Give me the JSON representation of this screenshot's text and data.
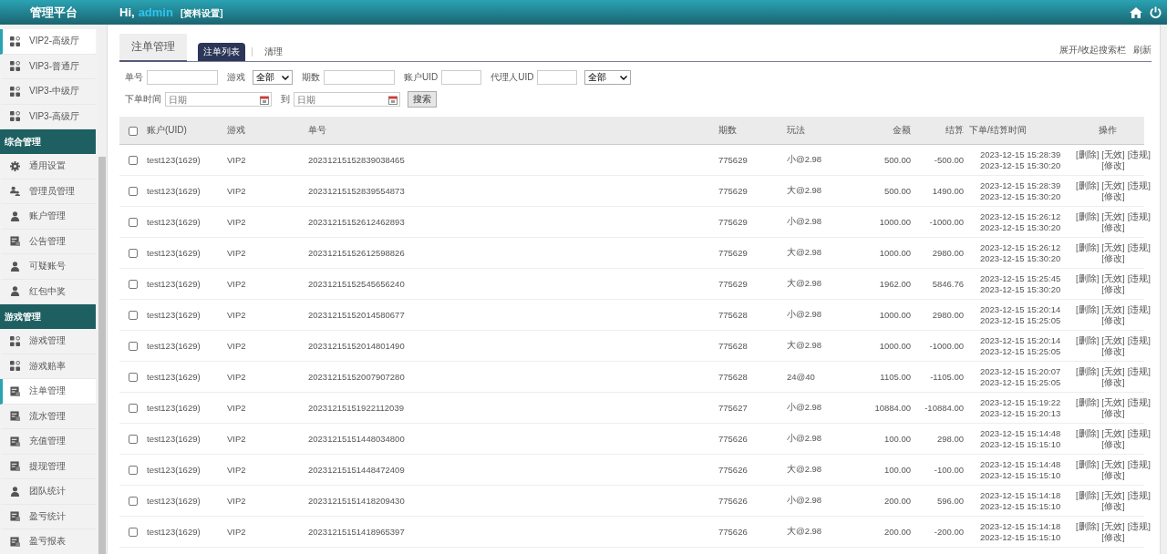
{
  "header": {
    "brand": "管理平台",
    "greeting": "Hi,",
    "user": "admin",
    "profile_link": "[资料设置]"
  },
  "sidebar": {
    "items": [
      {
        "kind": "item",
        "label": "VIP2-高级厅",
        "selected": true
      },
      {
        "kind": "item",
        "label": "VIP3-普通厅",
        "selected": false
      },
      {
        "kind": "item",
        "label": "VIP3-中级厅",
        "selected": false
      },
      {
        "kind": "item",
        "label": "VIP3-高级厅",
        "selected": false
      },
      {
        "kind": "section",
        "label": "综合管理"
      },
      {
        "kind": "item",
        "label": "通用设置",
        "selected": false
      },
      {
        "kind": "item",
        "label": "管理员管理",
        "selected": false
      },
      {
        "kind": "item",
        "label": "账户管理",
        "selected": false
      },
      {
        "kind": "item",
        "label": "公告管理",
        "selected": false
      },
      {
        "kind": "item",
        "label": "可疑账号",
        "selected": false
      },
      {
        "kind": "item",
        "label": "红包中奖",
        "selected": false
      },
      {
        "kind": "section",
        "label": "游戏管理"
      },
      {
        "kind": "item",
        "label": "游戏管理",
        "selected": false
      },
      {
        "kind": "item",
        "label": "游戏赔率",
        "selected": false
      },
      {
        "kind": "item",
        "label": "注单管理",
        "selected": true
      },
      {
        "kind": "item",
        "label": "流水管理",
        "selected": false
      },
      {
        "kind": "item",
        "label": "充值管理",
        "selected": false
      },
      {
        "kind": "item",
        "label": "提现管理",
        "selected": false
      },
      {
        "kind": "item",
        "label": "团队统计",
        "selected": false
      },
      {
        "kind": "item",
        "label": "盈亏统计",
        "selected": false
      },
      {
        "kind": "item",
        "label": "盈亏报表",
        "selected": false
      }
    ]
  },
  "page_tab": "注单管理",
  "sub_tabs": [
    {
      "label": "注单列表",
      "selected": true
    },
    {
      "label": "清理",
      "selected": false
    }
  ],
  "toolbar_links": [
    "展开/收起搜索栏",
    "刷新"
  ],
  "filters": {
    "order_no": {
      "label": "单号"
    },
    "game": {
      "label": "游戏",
      "value": "全部"
    },
    "period": {
      "label": "期数"
    },
    "account_uid": {
      "label": "账户UID"
    },
    "agent_uid": {
      "label": "代理人UID"
    },
    "status": {
      "value": "全部"
    },
    "time_label": "下单时间",
    "date_from": {
      "placeholder": "日期"
    },
    "to_label": "到",
    "date_to": {
      "placeholder": "日期"
    },
    "search_button": "搜索"
  },
  "table": {
    "select_all": {
      "checked": false
    },
    "columns": [
      "账户(UID)",
      "游戏",
      "单号",
      "期数",
      "玩法",
      "金额",
      "结算",
      "下单/结算时间",
      "操作"
    ],
    "rows": [
      {
        "checked": false,
        "account": "test123(1629)",
        "game": "VIP2",
        "order_no": "20231215152839038465",
        "period": "775629",
        "bet": "小@2.98",
        "amount": "500.00",
        "settle": "-500.00",
        "order_time": "2023-12-15 15:28:39",
        "settle_time": "2023-12-15 15:30:20",
        "actions": [
          "[删除]",
          "[无效]",
          "[违规]",
          "[修改]"
        ]
      },
      {
        "checked": false,
        "account": "test123(1629)",
        "game": "VIP2",
        "order_no": "20231215152839554873",
        "period": "775629",
        "bet": "大@2.98",
        "amount": "500.00",
        "settle": "1490.00",
        "order_time": "2023-12-15 15:28:39",
        "settle_time": "2023-12-15 15:30:20",
        "actions": [
          "[删除]",
          "[无效]",
          "[违规]",
          "[修改]"
        ]
      },
      {
        "checked": false,
        "account": "test123(1629)",
        "game": "VIP2",
        "order_no": "20231215152612462893",
        "period": "775629",
        "bet": "小@2.98",
        "amount": "1000.00",
        "settle": "-1000.00",
        "order_time": "2023-12-15 15:26:12",
        "settle_time": "2023-12-15 15:30:20",
        "actions": [
          "[删除]",
          "[无效]",
          "[违规]",
          "[修改]"
        ]
      },
      {
        "checked": false,
        "account": "test123(1629)",
        "game": "VIP2",
        "order_no": "20231215152612598826",
        "period": "775629",
        "bet": "大@2.98",
        "amount": "1000.00",
        "settle": "2980.00",
        "order_time": "2023-12-15 15:26:12",
        "settle_time": "2023-12-15 15:30:20",
        "actions": [
          "[删除]",
          "[无效]",
          "[违规]",
          "[修改]"
        ]
      },
      {
        "checked": false,
        "account": "test123(1629)",
        "game": "VIP2",
        "order_no": "20231215152545656240",
        "period": "775629",
        "bet": "大@2.98",
        "amount": "1962.00",
        "settle": "5846.76",
        "order_time": "2023-12-15 15:25:45",
        "settle_time": "2023-12-15 15:30:20",
        "actions": [
          "[删除]",
          "[无效]",
          "[违规]",
          "[修改]"
        ]
      },
      {
        "checked": false,
        "account": "test123(1629)",
        "game": "VIP2",
        "order_no": "20231215152014580677",
        "period": "775628",
        "bet": "小@2.98",
        "amount": "1000.00",
        "settle": "2980.00",
        "order_time": "2023-12-15 15:20:14",
        "settle_time": "2023-12-15 15:25:05",
        "actions": [
          "[删除]",
          "[无效]",
          "[违规]",
          "[修改]"
        ]
      },
      {
        "checked": false,
        "account": "test123(1629)",
        "game": "VIP2",
        "order_no": "20231215152014801490",
        "period": "775628",
        "bet": "大@2.98",
        "amount": "1000.00",
        "settle": "-1000.00",
        "order_time": "2023-12-15 15:20:14",
        "settle_time": "2023-12-15 15:25:05",
        "actions": [
          "[删除]",
          "[无效]",
          "[违规]",
          "[修改]"
        ]
      },
      {
        "checked": false,
        "account": "test123(1629)",
        "game": "VIP2",
        "order_no": "20231215152007907280",
        "period": "775628",
        "bet": "24@40",
        "amount": "1105.00",
        "settle": "-1105.00",
        "order_time": "2023-12-15 15:20:07",
        "settle_time": "2023-12-15 15:25:05",
        "actions": [
          "[删除]",
          "[无效]",
          "[违规]",
          "[修改]"
        ]
      },
      {
        "checked": false,
        "account": "test123(1629)",
        "game": "VIP2",
        "order_no": "20231215151922112039",
        "period": "775627",
        "bet": "小@2.98",
        "amount": "10884.00",
        "settle": "-10884.00",
        "order_time": "2023-12-15 15:19:22",
        "settle_time": "2023-12-15 15:20:13",
        "actions": [
          "[删除]",
          "[无效]",
          "[违规]",
          "[修改]"
        ]
      },
      {
        "checked": false,
        "account": "test123(1629)",
        "game": "VIP2",
        "order_no": "20231215151448034800",
        "period": "775626",
        "bet": "小@2.98",
        "amount": "100.00",
        "settle": "298.00",
        "order_time": "2023-12-15 15:14:48",
        "settle_time": "2023-12-15 15:15:10",
        "actions": [
          "[删除]",
          "[无效]",
          "[违规]",
          "[修改]"
        ]
      },
      {
        "checked": false,
        "account": "test123(1629)",
        "game": "VIP2",
        "order_no": "20231215151448472409",
        "period": "775626",
        "bet": "大@2.98",
        "amount": "100.00",
        "settle": "-100.00",
        "order_time": "2023-12-15 15:14:48",
        "settle_time": "2023-12-15 15:15:10",
        "actions": [
          "[删除]",
          "[无效]",
          "[违规]",
          "[修改]"
        ]
      },
      {
        "checked": false,
        "account": "test123(1629)",
        "game": "VIP2",
        "order_no": "20231215151418209430",
        "period": "775626",
        "bet": "小@2.98",
        "amount": "200.00",
        "settle": "596.00",
        "order_time": "2023-12-15 15:14:18",
        "settle_time": "2023-12-15 15:15:10",
        "actions": [
          "[删除]",
          "[无效]",
          "[违规]",
          "[修改]"
        ]
      },
      {
        "checked": false,
        "account": "test123(1629)",
        "game": "VIP2",
        "order_no": "20231215151418965397",
        "period": "775626",
        "bet": "大@2.98",
        "amount": "200.00",
        "settle": "-200.00",
        "order_time": "2023-12-15 15:14:18",
        "settle_time": "2023-12-15 15:15:10",
        "actions": [
          "[删除]",
          "[无效]",
          "[违规]",
          "[修改]"
        ]
      }
    ]
  }
}
